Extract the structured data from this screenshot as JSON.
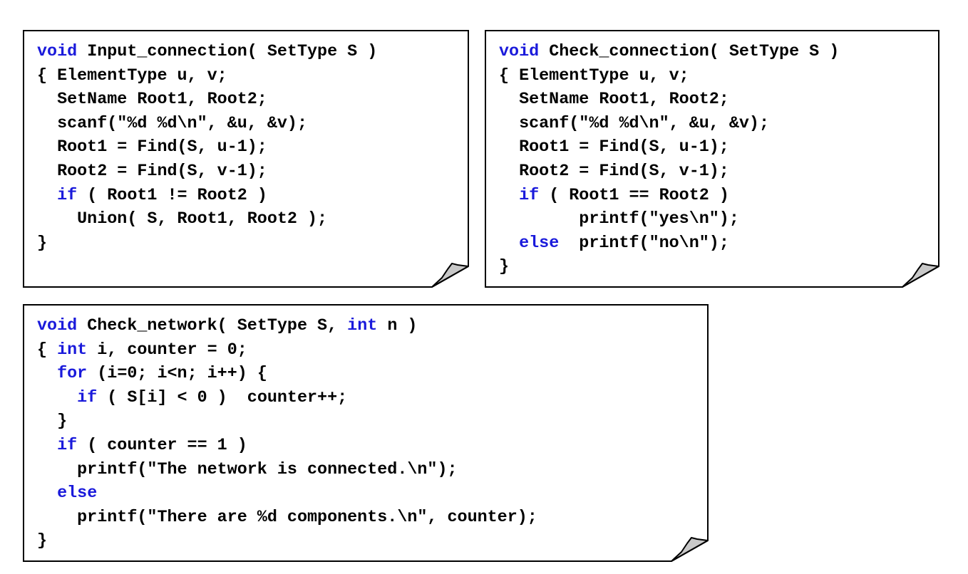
{
  "boxes": {
    "input_connection": {
      "lines": [
        [
          {
            "t": "void",
            "kw": true
          },
          {
            "t": " Input_connection( SetType S )"
          }
        ],
        [
          {
            "t": "{ ElementType u, v;"
          }
        ],
        [
          {
            "t": "  SetName Root1, Root2;"
          }
        ],
        [
          {
            "t": "  scanf(\"%d %d\\n\", &u, &v);"
          }
        ],
        [
          {
            "t": "  Root1 = Find(S, u-1);"
          }
        ],
        [
          {
            "t": "  Root2 = Find(S, v-1);"
          }
        ],
        [
          {
            "t": "  "
          },
          {
            "t": "if",
            "kw": true
          },
          {
            "t": " ( Root1 != Root2 )"
          }
        ],
        [
          {
            "t": "    Union( S, Root1, Root2 );"
          }
        ],
        [
          {
            "t": "}"
          }
        ]
      ]
    },
    "check_connection": {
      "lines": [
        [
          {
            "t": "void",
            "kw": true
          },
          {
            "t": " Check_connection( SetType S )"
          }
        ],
        [
          {
            "t": "{ ElementType u, v;"
          }
        ],
        [
          {
            "t": "  SetName Root1, Root2;"
          }
        ],
        [
          {
            "t": "  scanf(\"%d %d\\n\", &u, &v);"
          }
        ],
        [
          {
            "t": "  Root1 = Find(S, u-1);"
          }
        ],
        [
          {
            "t": "  Root2 = Find(S, v-1);"
          }
        ],
        [
          {
            "t": "  "
          },
          {
            "t": "if",
            "kw": true
          },
          {
            "t": " ( Root1 == Root2 )"
          }
        ],
        [
          {
            "t": "        printf(\"yes\\n\");"
          }
        ],
        [
          {
            "t": "  "
          },
          {
            "t": "else",
            "kw": true
          },
          {
            "t": "  printf(\"no\\n\");"
          }
        ],
        [
          {
            "t": "}"
          }
        ]
      ]
    },
    "check_network": {
      "lines": [
        [
          {
            "t": "void",
            "kw": true
          },
          {
            "t": " Check_network( SetType S, "
          },
          {
            "t": "int",
            "kw": true
          },
          {
            "t": " n )"
          }
        ],
        [
          {
            "t": "{ "
          },
          {
            "t": "int",
            "kw": true
          },
          {
            "t": " i, counter = 0;"
          }
        ],
        [
          {
            "t": "  "
          },
          {
            "t": "for",
            "kw": true
          },
          {
            "t": " (i=0; i<n; i++) {"
          }
        ],
        [
          {
            "t": "    "
          },
          {
            "t": "if",
            "kw": true
          },
          {
            "t": " ( S[i] < 0 )  counter++;"
          }
        ],
        [
          {
            "t": "  }"
          }
        ],
        [
          {
            "t": "  "
          },
          {
            "t": "if",
            "kw": true
          },
          {
            "t": " ( counter == 1 )"
          }
        ],
        [
          {
            "t": "    printf(\"The network is connected.\\n\");"
          }
        ],
        [
          {
            "t": "  "
          },
          {
            "t": "else",
            "kw": true
          }
        ],
        [
          {
            "t": "    printf(\"There are %d components.\\n\", counter);"
          }
        ],
        [
          {
            "t": "}"
          }
        ]
      ]
    }
  },
  "colors": {
    "keyword": "#1a1adb",
    "text": "#000000",
    "fold": "#c8c8c8",
    "border": "#000000"
  }
}
